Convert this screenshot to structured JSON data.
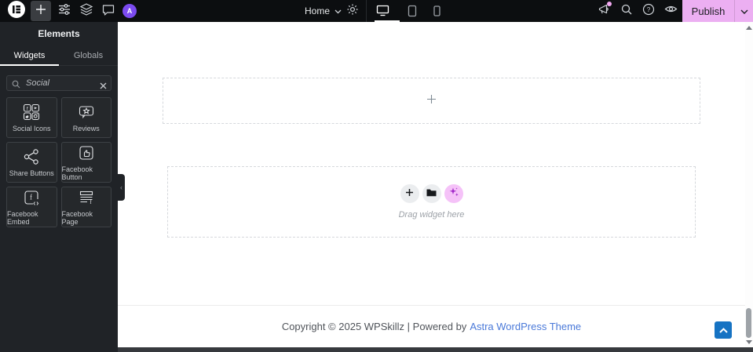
{
  "topbar": {
    "menu_label": "Home",
    "publish_label": "Publish",
    "avatar_letter": "A"
  },
  "panel": {
    "title": "Elements",
    "tabs": [
      {
        "label": "Widgets",
        "active": true
      },
      {
        "label": "Globals",
        "active": false
      }
    ],
    "search_value": "Social",
    "widgets": [
      {
        "label": "Social Icons",
        "icon": "social-icons-icon"
      },
      {
        "label": "Reviews",
        "icon": "reviews-icon"
      },
      {
        "label": "Share Buttons",
        "icon": "share-buttons-icon"
      },
      {
        "label": "Facebook Button",
        "icon": "facebook-button-icon"
      },
      {
        "label": "Facebook Embed",
        "icon": "facebook-embed-icon"
      },
      {
        "label": "Facebook Page",
        "icon": "facebook-page-icon"
      }
    ]
  },
  "canvas": {
    "drag_hint": "Drag widget here",
    "footer": {
      "copyright_prefix": "Copyright © 2025 WPSkillz | Powered by",
      "theme_link": "Astra WordPress Theme"
    }
  },
  "colors": {
    "publish_pink": "#ecaff2",
    "ai_pink": "#f5c2f8",
    "notification_pink": "#f3a9f2",
    "link_blue": "#4a79d9",
    "scrolltop_blue": "#1673c3",
    "avatar_purple": "#7c4bf0"
  }
}
